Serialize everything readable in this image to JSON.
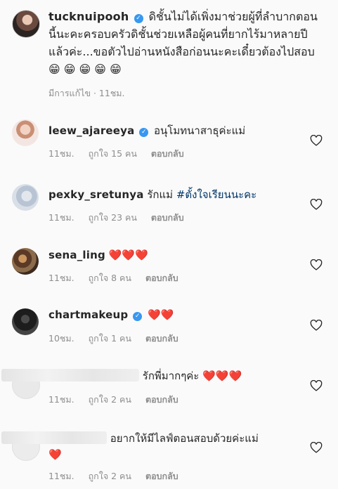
{
  "post": {
    "username": "tucknuipooh",
    "caption": "ดิชั้นไม่ได้เพิ่งมาช่วยผู้ที่ลำบากตอนนี้นะคะครอบครัวดิชั้นช่วยเหลือผู้คนที่ยากไร้มาหลายปีแล้วค่ะ...ขอตัวไปอ่านหนังสือก่อนนะคะเดี๋ยวต้องไปสอบ",
    "emoji": "😁 😁 😁 😁 😁",
    "meta": "มีการแก้ไข · 11ชม."
  },
  "comments": [
    {
      "username": "leew_ajareeya",
      "verified": true,
      "text": "อนุโมทนาสาธุค่ะแม่",
      "time": "11ชม.",
      "likes": "ถูกใจ 15 คน",
      "reply": "ตอบกลับ"
    },
    {
      "username": "pexky_sretunya",
      "verified": false,
      "text": "รักแม่",
      "hashtag": "#ตั้งใจเรียนนะคะ",
      "time": "11ชม.",
      "likes": "ถูกใจ 23 คน",
      "reply": "ตอบกลับ"
    },
    {
      "username": "sena_ling",
      "verified": false,
      "text": "",
      "hearts": "❤️❤️❤️",
      "time": "11ชม.",
      "likes": "ถูกใจ 8 คน",
      "reply": "ตอบกลับ"
    },
    {
      "username": "chartmakeup",
      "verified": true,
      "text": "",
      "hearts": "❤️❤️",
      "time": "10ชม.",
      "likes": "ถูกใจ 1 คน",
      "reply": "ตอบกลับ"
    },
    {
      "username": "",
      "verified": false,
      "text": "รักพี่มากๆค่ะ",
      "hearts": "❤️❤️❤️",
      "time": "11ชม.",
      "likes": "ถูกใจ 2 คน",
      "reply": "ตอบกลับ"
    },
    {
      "username": "",
      "verified": false,
      "text": "อยากให้มีไลฟ์ตอนสอบด้วยค่ะแม่",
      "hearts": "❤️",
      "time": "11ชม.",
      "likes": "ถูกใจ 2 คน",
      "reply": "ตอบกลับ"
    }
  ],
  "icons": {
    "like": "heart-outline-icon",
    "verified": "verified-badge-icon"
  },
  "colors": {
    "verified": "#3897f0",
    "meta": "#8e8e8e",
    "hashtag": "#003569"
  }
}
